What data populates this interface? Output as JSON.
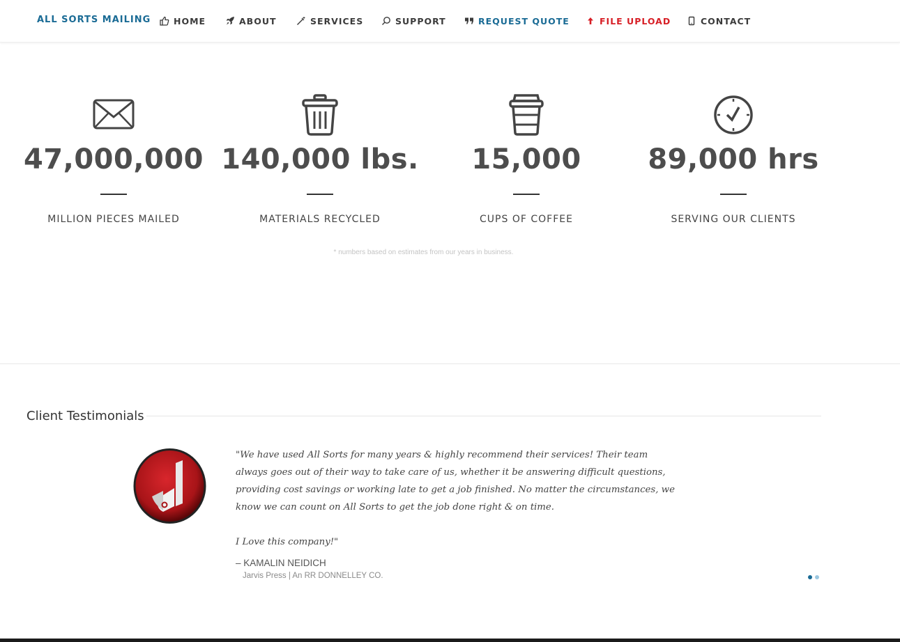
{
  "nav": {
    "brand": "ALL SORTS MAILING",
    "items": [
      {
        "label": "HOME",
        "icon": "thumbs-up-icon"
      },
      {
        "label": "ABOUT",
        "icon": "rocket-icon"
      },
      {
        "label": "SERVICES",
        "icon": "magic-wand-icon"
      },
      {
        "label": "SUPPORT",
        "icon": "search-icon"
      },
      {
        "label": "REQUEST QUOTE",
        "icon": "quote-icon"
      },
      {
        "label": "FILE UPLOAD",
        "icon": "upload-arrow-icon"
      },
      {
        "label": "CONTACT",
        "icon": "mobile-phone-icon"
      }
    ],
    "colors": {
      "brand": "#1a6b95",
      "upload": "#d71f26"
    }
  },
  "stats": [
    {
      "icon": "envelope-icon",
      "number": "47,000,000",
      "label": "MILLION PIECES MAILED"
    },
    {
      "icon": "trash-can-icon",
      "number": "140,000 lbs.",
      "label": "MATERIALS RECYCLED"
    },
    {
      "icon": "coffee-cup-icon",
      "number": "15,000",
      "label": "CUPS OF COFFEE"
    },
    {
      "icon": "clock-icon",
      "number": "89,000 hrs",
      "label": "SERVING OUR CLIENTS"
    }
  ],
  "footnote": "* numbers based on estimates from our years in business.",
  "testimonials": {
    "title": "Client Testimonials",
    "quote_p1": "\"We have used All Sorts for many years & highly recommend their services! Their team always goes out of their way to take care of us, whether it be answering difficult questions, providing cost savings or working late to get a job finished. No matter the circumstances, we know we can count on All Sorts to get the job done right & on time.",
    "quote_p2": "I Love this company!\"",
    "author": "– KAMALIN NEIDICH",
    "company": "Jarvis Press | An RR DONNELLEY CO.",
    "slides": 2,
    "active_slide": 1
  }
}
